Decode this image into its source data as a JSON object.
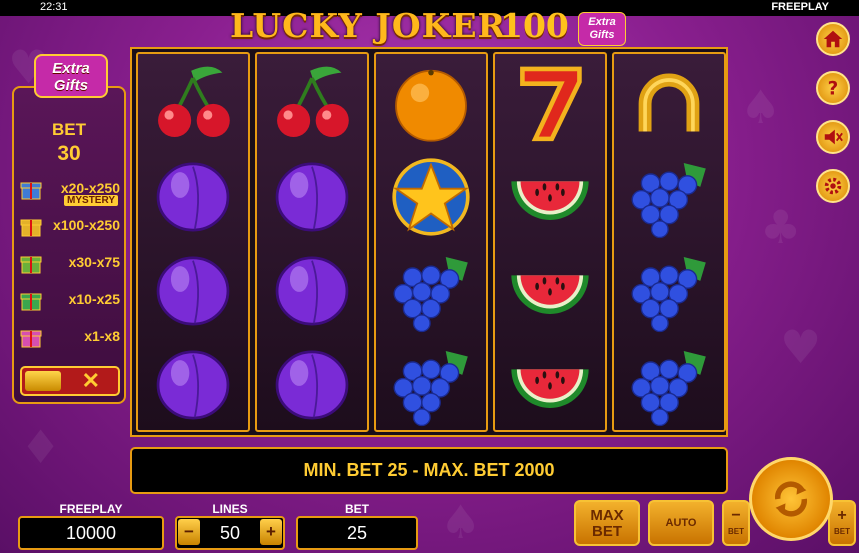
{
  "status_bar": {
    "time": "22:31",
    "mode": "FREEPLAY"
  },
  "title": {
    "main": "LUCKY JOKER",
    "number": "100",
    "badge": "Extra Gifts"
  },
  "side_panel": {
    "logo": "Extra Gifts",
    "bet_label": "BET",
    "bet_value": "30",
    "prizes": [
      {
        "range": "x20-x250",
        "tag": "MYSTERY",
        "gift_color": "#3f7bd6"
      },
      {
        "range": "x100-x250",
        "gift_color": "#e3b12a"
      },
      {
        "range": "x30-x75",
        "gift_color": "#6ab03a"
      },
      {
        "range": "x10-x25",
        "gift_color": "#3aa64e"
      },
      {
        "range": "x1-x8",
        "gift_color": "#d64fb0"
      }
    ],
    "toggle_symbol": "✕"
  },
  "reels": [
    [
      "cherry",
      "plum",
      "plum",
      "plum"
    ],
    [
      "cherry",
      "plum",
      "plum",
      "plum"
    ],
    [
      "orange",
      "star",
      "grapes",
      "grapes"
    ],
    [
      "seven",
      "watermelon",
      "watermelon",
      "watermelon"
    ],
    [
      "horseshoe",
      "grapes",
      "grapes",
      "grapes"
    ]
  ],
  "info_bar": {
    "message": "MIN. BET 25 - MAX. BET 2000"
  },
  "side_buttons": [
    "home-icon",
    "help-icon",
    "sound-off-icon",
    "settings-icon"
  ],
  "bottom": {
    "freeplay_label": "FREEPLAY",
    "freeplay_value": "10000",
    "lines_label": "LINES",
    "lines_value": "50",
    "lines_minus": "−",
    "lines_plus": "+",
    "bet_label": "BET",
    "bet_value": "25",
    "maxbet_label": "MAX BET",
    "auto_label": "AUTO",
    "bet_minus": "−",
    "bet_minus_label": "BET",
    "bet_plus": "+",
    "bet_plus_label": "BET"
  },
  "colors": {
    "accent": "#e79b12",
    "gold_text": "#ffcc33",
    "background": "#8a1f8f"
  }
}
